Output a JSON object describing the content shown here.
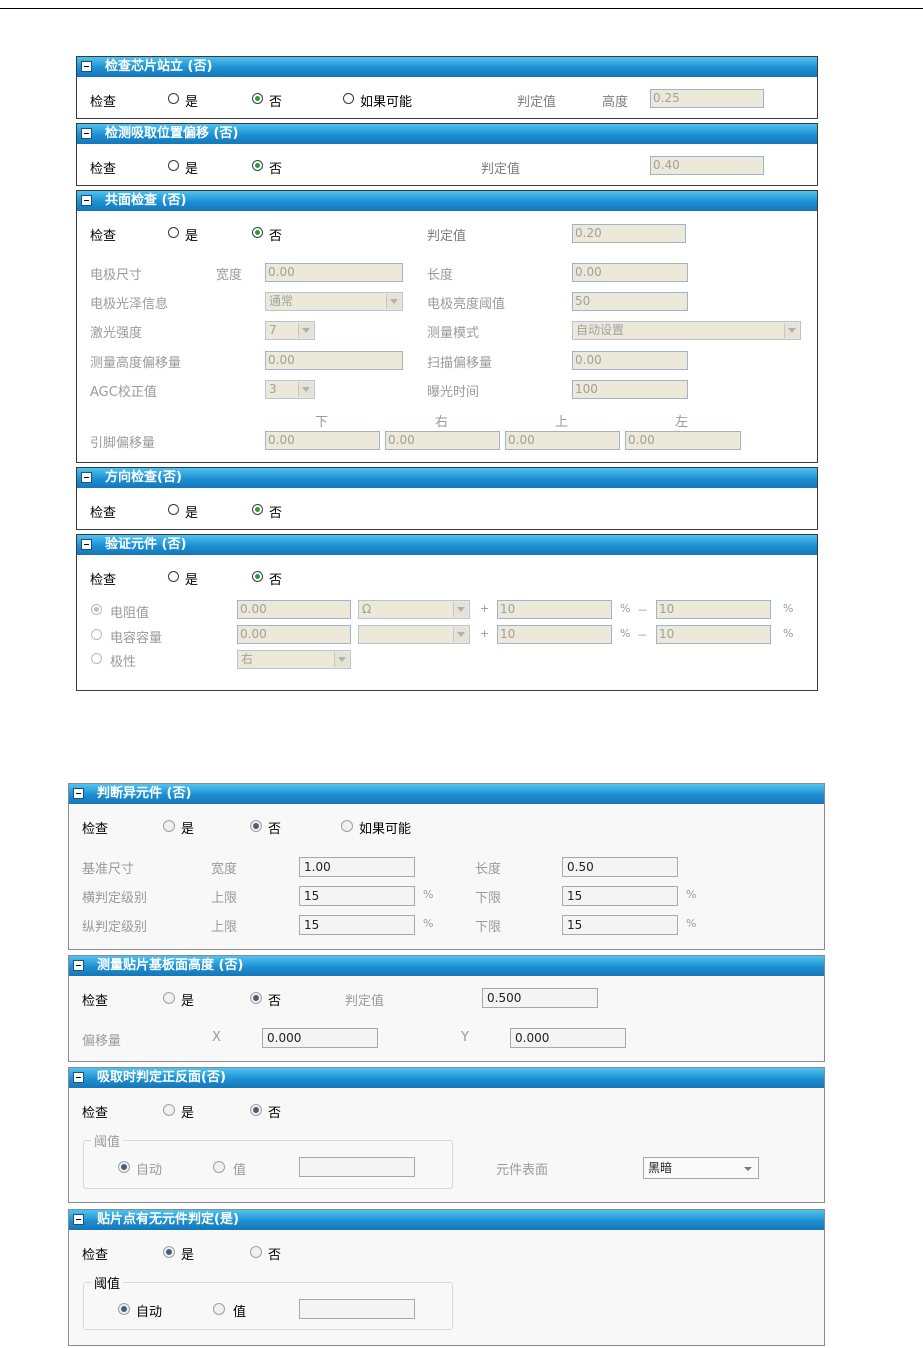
{
  "common": {
    "check": "检查",
    "yes": "是",
    "no": "否",
    "if_possible": "如果可能",
    "judge": "判定值",
    "percent": "%",
    "plus": "+",
    "minus": "－"
  },
  "p1": {
    "title": "检查芯片站立 (否)",
    "height_label": "高度",
    "height_value": "0.25"
  },
  "p2": {
    "title": "检测吸取位置偏移 (否)",
    "judge_value": "0.40"
  },
  "p3": {
    "title": "共面检查 (否)",
    "judge_value": "0.20",
    "electrode_size": "电极尺寸",
    "width": "宽度",
    "width_value": "0.00",
    "length": "长度",
    "length_value": "0.00",
    "gloss_info": "电极光泽信息",
    "gloss_value": "通常",
    "brightness_threshold": "电极亮度阈值",
    "brightness_value": "50",
    "laser_strength": "激光强度",
    "laser_value": "7",
    "measure_mode": "测量模式",
    "measure_mode_value": "自动设置",
    "height_offset": "测量高度偏移量",
    "height_offset_value": "0.00",
    "scan_offset": "扫描偏移量",
    "scan_offset_value": "0.00",
    "agc": "AGC校正值",
    "agc_value": "3",
    "exposure": "曝光时间",
    "exposure_value": "100",
    "dir_down": "下",
    "dir_right": "右",
    "dir_up": "上",
    "dir_left": "左",
    "lead_offset": "引脚偏移量",
    "lead_down": "0.00",
    "lead_right": "0.00",
    "lead_up": "0.00",
    "lead_left": "0.00"
  },
  "p4": {
    "title": "方向检查(否)"
  },
  "p5": {
    "title": "验证元件 (否)",
    "resistance": "电阻值",
    "res_value": "0.00",
    "res_unit": "Ω",
    "res_plus": "10",
    "res_minus": "10",
    "capacitance": "电容容量",
    "cap_value": "0.00",
    "cap_plus": "10",
    "cap_minus": "10",
    "polarity": "极性",
    "polarity_value": "右"
  },
  "p6": {
    "title": "判断异元件 (否)",
    "base_size": "基准尺寸",
    "width": "宽度",
    "width_value": "1.00",
    "length": "长度",
    "length_value": "0.50",
    "h_level": "横判定级别",
    "v_level": "纵判定级别",
    "upper": "上限",
    "lower": "下限",
    "h_upper": "15",
    "h_lower": "15",
    "v_upper": "15",
    "v_lower": "15"
  },
  "p7": {
    "title": "测量贴片基板面高度 (否)",
    "judge_value": "0.500",
    "offset": "偏移量",
    "x": "X",
    "x_value": "0.000",
    "y": "Y",
    "y_value": "0.000"
  },
  "p8": {
    "title": "吸取时判定正反面(否)",
    "threshold": "阈值",
    "auto": "自动",
    "value": "值",
    "surface": "元件表面",
    "surface_value": "黑暗"
  },
  "p9": {
    "title": "贴片点有无元件判定(是)",
    "threshold": "阈值",
    "auto": "自动",
    "value": "值"
  }
}
